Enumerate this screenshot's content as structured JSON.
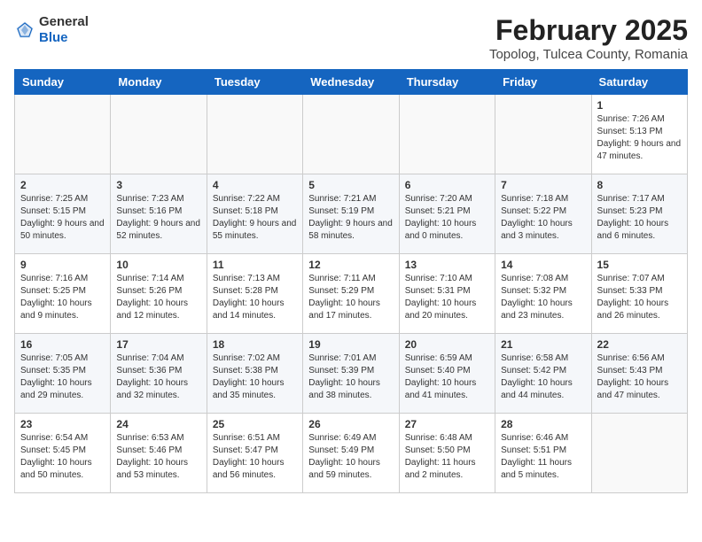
{
  "header": {
    "logo_general": "General",
    "logo_blue": "Blue",
    "month_year": "February 2025",
    "location": "Topolog, Tulcea County, Romania"
  },
  "weekdays": [
    "Sunday",
    "Monday",
    "Tuesday",
    "Wednesday",
    "Thursday",
    "Friday",
    "Saturday"
  ],
  "weeks": [
    [
      {
        "day": "",
        "info": ""
      },
      {
        "day": "",
        "info": ""
      },
      {
        "day": "",
        "info": ""
      },
      {
        "day": "",
        "info": ""
      },
      {
        "day": "",
        "info": ""
      },
      {
        "day": "",
        "info": ""
      },
      {
        "day": "1",
        "info": "Sunrise: 7:26 AM\nSunset: 5:13 PM\nDaylight: 9 hours and 47 minutes."
      }
    ],
    [
      {
        "day": "2",
        "info": "Sunrise: 7:25 AM\nSunset: 5:15 PM\nDaylight: 9 hours and 50 minutes."
      },
      {
        "day": "3",
        "info": "Sunrise: 7:23 AM\nSunset: 5:16 PM\nDaylight: 9 hours and 52 minutes."
      },
      {
        "day": "4",
        "info": "Sunrise: 7:22 AM\nSunset: 5:18 PM\nDaylight: 9 hours and 55 minutes."
      },
      {
        "day": "5",
        "info": "Sunrise: 7:21 AM\nSunset: 5:19 PM\nDaylight: 9 hours and 58 minutes."
      },
      {
        "day": "6",
        "info": "Sunrise: 7:20 AM\nSunset: 5:21 PM\nDaylight: 10 hours and 0 minutes."
      },
      {
        "day": "7",
        "info": "Sunrise: 7:18 AM\nSunset: 5:22 PM\nDaylight: 10 hours and 3 minutes."
      },
      {
        "day": "8",
        "info": "Sunrise: 7:17 AM\nSunset: 5:23 PM\nDaylight: 10 hours and 6 minutes."
      }
    ],
    [
      {
        "day": "9",
        "info": "Sunrise: 7:16 AM\nSunset: 5:25 PM\nDaylight: 10 hours and 9 minutes."
      },
      {
        "day": "10",
        "info": "Sunrise: 7:14 AM\nSunset: 5:26 PM\nDaylight: 10 hours and 12 minutes."
      },
      {
        "day": "11",
        "info": "Sunrise: 7:13 AM\nSunset: 5:28 PM\nDaylight: 10 hours and 14 minutes."
      },
      {
        "day": "12",
        "info": "Sunrise: 7:11 AM\nSunset: 5:29 PM\nDaylight: 10 hours and 17 minutes."
      },
      {
        "day": "13",
        "info": "Sunrise: 7:10 AM\nSunset: 5:31 PM\nDaylight: 10 hours and 20 minutes."
      },
      {
        "day": "14",
        "info": "Sunrise: 7:08 AM\nSunset: 5:32 PM\nDaylight: 10 hours and 23 minutes."
      },
      {
        "day": "15",
        "info": "Sunrise: 7:07 AM\nSunset: 5:33 PM\nDaylight: 10 hours and 26 minutes."
      }
    ],
    [
      {
        "day": "16",
        "info": "Sunrise: 7:05 AM\nSunset: 5:35 PM\nDaylight: 10 hours and 29 minutes."
      },
      {
        "day": "17",
        "info": "Sunrise: 7:04 AM\nSunset: 5:36 PM\nDaylight: 10 hours and 32 minutes."
      },
      {
        "day": "18",
        "info": "Sunrise: 7:02 AM\nSunset: 5:38 PM\nDaylight: 10 hours and 35 minutes."
      },
      {
        "day": "19",
        "info": "Sunrise: 7:01 AM\nSunset: 5:39 PM\nDaylight: 10 hours and 38 minutes."
      },
      {
        "day": "20",
        "info": "Sunrise: 6:59 AM\nSunset: 5:40 PM\nDaylight: 10 hours and 41 minutes."
      },
      {
        "day": "21",
        "info": "Sunrise: 6:58 AM\nSunset: 5:42 PM\nDaylight: 10 hours and 44 minutes."
      },
      {
        "day": "22",
        "info": "Sunrise: 6:56 AM\nSunset: 5:43 PM\nDaylight: 10 hours and 47 minutes."
      }
    ],
    [
      {
        "day": "23",
        "info": "Sunrise: 6:54 AM\nSunset: 5:45 PM\nDaylight: 10 hours and 50 minutes."
      },
      {
        "day": "24",
        "info": "Sunrise: 6:53 AM\nSunset: 5:46 PM\nDaylight: 10 hours and 53 minutes."
      },
      {
        "day": "25",
        "info": "Sunrise: 6:51 AM\nSunset: 5:47 PM\nDaylight: 10 hours and 56 minutes."
      },
      {
        "day": "26",
        "info": "Sunrise: 6:49 AM\nSunset: 5:49 PM\nDaylight: 10 hours and 59 minutes."
      },
      {
        "day": "27",
        "info": "Sunrise: 6:48 AM\nSunset: 5:50 PM\nDaylight: 11 hours and 2 minutes."
      },
      {
        "day": "28",
        "info": "Sunrise: 6:46 AM\nSunset: 5:51 PM\nDaylight: 11 hours and 5 minutes."
      },
      {
        "day": "",
        "info": ""
      }
    ]
  ]
}
